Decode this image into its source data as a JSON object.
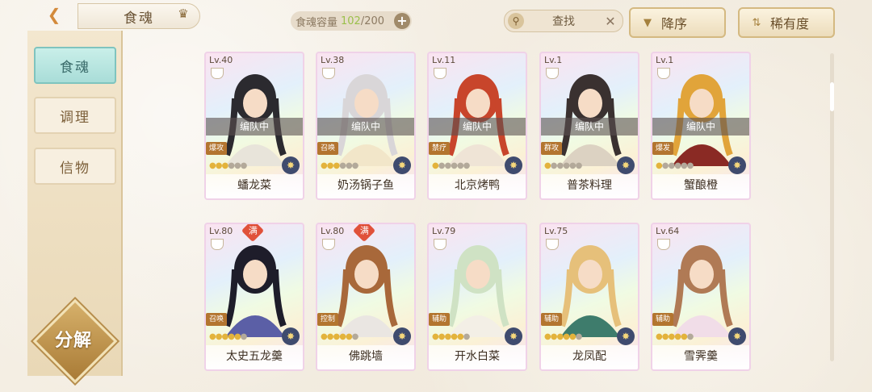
{
  "header": {
    "title": "食魂",
    "capacity_label": "食魂容量",
    "capacity_current": "102",
    "capacity_max": "/200",
    "search_placeholder": "查找",
    "sort_label": "降序",
    "rarity_label": "稀有度"
  },
  "sidebar": {
    "items": [
      {
        "label": "食魂",
        "active": true
      },
      {
        "label": "调理",
        "active": false
      },
      {
        "label": "信物",
        "active": false
      }
    ],
    "decompose_label": "分解"
  },
  "cards": [
    {
      "level": "Lv.40",
      "team": "编队中",
      "role": "爆攻",
      "stars_on": 3,
      "stars_total": 6,
      "name": "蟠龙菜",
      "full": false,
      "colors": [
        "#2b2a2f",
        "#e8e4da"
      ]
    },
    {
      "level": "Lv.38",
      "team": "编队中",
      "role": "召唤",
      "stars_on": 3,
      "stars_total": 6,
      "name": "奶汤锅子鱼",
      "full": false,
      "colors": [
        "#d9d6d8",
        "#f2e6c9"
      ]
    },
    {
      "level": "Lv.11",
      "team": "编队中",
      "role": "禁疗",
      "stars_on": 1,
      "stars_total": 6,
      "name": "北京烤鸭",
      "full": false,
      "colors": [
        "#c8452b",
        "#efe4d6"
      ]
    },
    {
      "level": "Lv.1",
      "team": "编队中",
      "role": "群攻",
      "stars_on": 1,
      "stars_total": 6,
      "name": "普茶料理",
      "full": false,
      "colors": [
        "#3a3130",
        "#dcd2c2"
      ]
    },
    {
      "level": "Lv.1",
      "team": "编队中",
      "role": "爆发",
      "stars_on": 1,
      "stars_total": 6,
      "name": "蟹酿橙",
      "full": false,
      "colors": [
        "#e1a43a",
        "#8a2a24"
      ]
    },
    {
      "level": "Lv.80",
      "team": "",
      "role": "召唤",
      "stars_on": 5,
      "stars_total": 6,
      "name": "太史五龙羹",
      "full": true,
      "full_label": "满",
      "colors": [
        "#1e1d2a",
        "#5b5fa6"
      ]
    },
    {
      "level": "Lv.80",
      "team": "",
      "role": "控制",
      "stars_on": 5,
      "stars_total": 6,
      "name": "佛跳墙",
      "full": true,
      "full_label": "满",
      "colors": [
        "#a8683a",
        "#eae6e2"
      ]
    },
    {
      "level": "Lv.79",
      "team": "",
      "role": "辅助",
      "stars_on": 5,
      "stars_total": 6,
      "name": "开水白菜",
      "full": false,
      "colors": [
        "#cfe2c4",
        "#f3efe6"
      ]
    },
    {
      "level": "Lv.75",
      "team": "",
      "role": "辅助",
      "stars_on": 5,
      "stars_total": 6,
      "name": "龙凤配",
      "full": false,
      "colors": [
        "#e6c07a",
        "#3e7c6c"
      ]
    },
    {
      "level": "Lv.64",
      "team": "",
      "role": "辅助",
      "stars_on": 5,
      "stars_total": 6,
      "name": "雪霁羹",
      "full": false,
      "colors": [
        "#b07a55",
        "#f1dde8"
      ]
    }
  ],
  "icons": {
    "back": "back-arrow-icon",
    "crown": "crown-icon",
    "add": "plus-icon",
    "search": "magnifier-icon",
    "clear": "close-icon",
    "sort": "triangle-down-icon",
    "rarity": "filter-icon"
  }
}
